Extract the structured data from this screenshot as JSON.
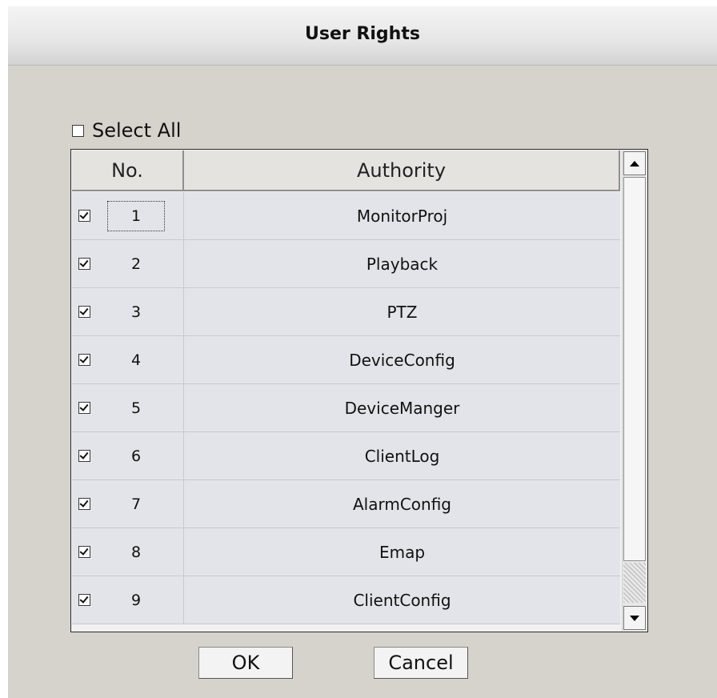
{
  "dialog": {
    "title": "User Rights"
  },
  "select_all": {
    "label": "Select All",
    "checked": false
  },
  "table": {
    "headers": {
      "no": "No.",
      "authority": "Authority"
    },
    "rows": [
      {
        "no": "1",
        "authority": "MonitorProj",
        "checked": true
      },
      {
        "no": "2",
        "authority": "Playback",
        "checked": true
      },
      {
        "no": "3",
        "authority": "PTZ",
        "checked": true
      },
      {
        "no": "4",
        "authority": "DeviceConfig",
        "checked": true
      },
      {
        "no": "5",
        "authority": "DeviceManger",
        "checked": true
      },
      {
        "no": "6",
        "authority": "ClientLog",
        "checked": true
      },
      {
        "no": "7",
        "authority": "AlarmConfig",
        "checked": true
      },
      {
        "no": "8",
        "authority": "Emap",
        "checked": true
      },
      {
        "no": "9",
        "authority": "ClientConfig",
        "checked": true
      }
    ]
  },
  "buttons": {
    "ok": "OK",
    "cancel": "Cancel"
  }
}
